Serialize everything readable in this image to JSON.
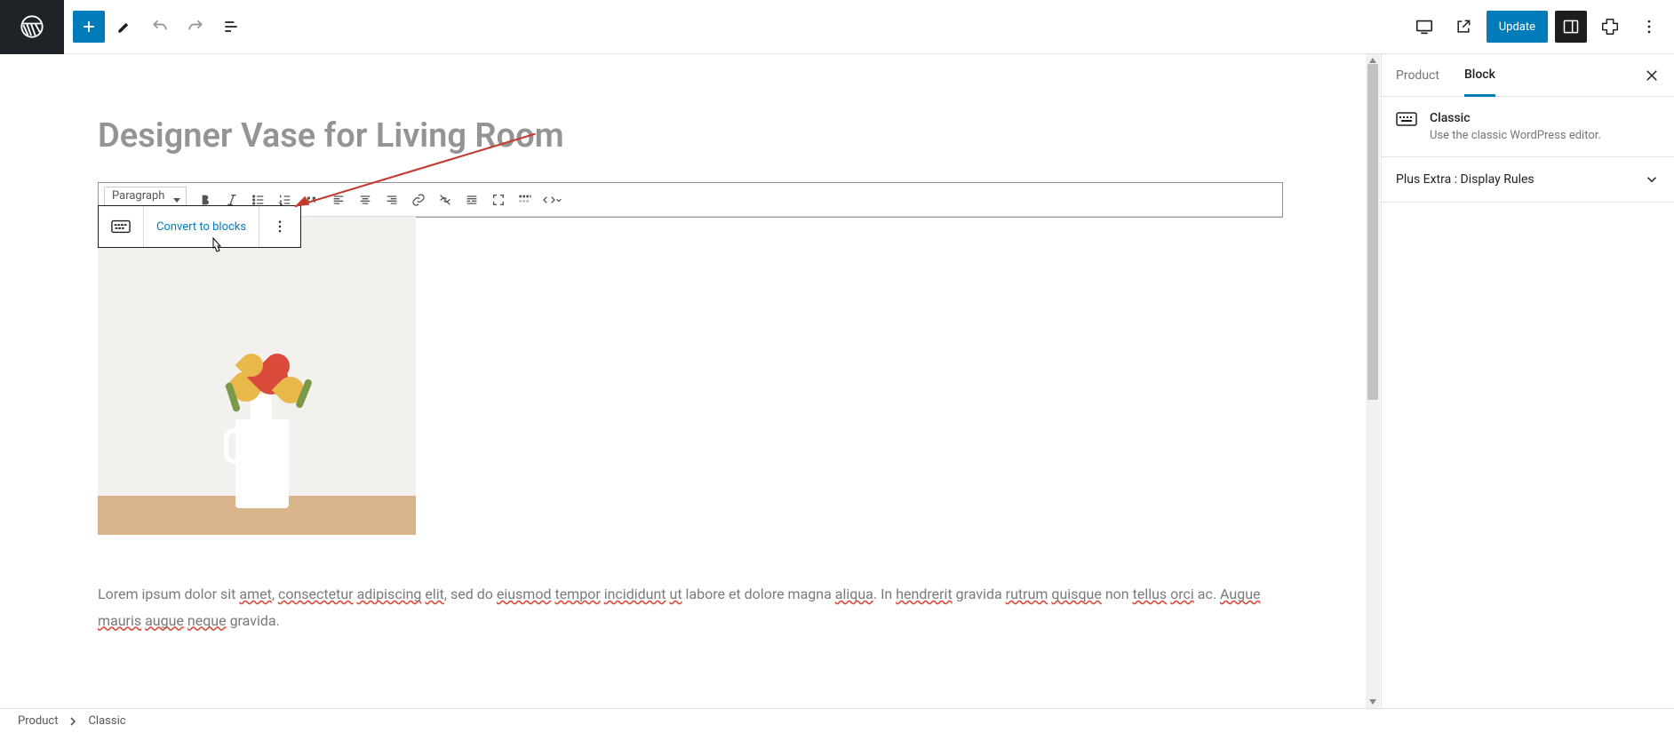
{
  "topbar": {
    "update_label": "Update"
  },
  "block_toolbar": {
    "convert_label": "Convert to blocks"
  },
  "post": {
    "title": "Designer Vase for Living Room"
  },
  "classic_editor": {
    "format_select": "Paragraph",
    "paragraph_pre": "Lorem ipsum dolor sit ",
    "w1": "amet",
    "s1": ", ",
    "w2": "consectetur",
    "s2": " ",
    "w3": "adipiscing",
    "s3": " ",
    "w4": "elit",
    "s4": ", sed do ",
    "w5": "eiusmod",
    "s5": " ",
    "w6": "tempor",
    "s6": " ",
    "w7": "incididunt",
    "s7": " ",
    "w8": "ut",
    "s8": " labore et dolore magna ",
    "w9": "aliqua",
    "s9": ". In ",
    "w10": "hendrerit",
    "s10": " gravida ",
    "w11": "rutrum",
    "s11": " ",
    "w12": "quisque",
    "s12": " non ",
    "w13": "tellus",
    "s13": " ",
    "w14": "orci",
    "s14": " ac. ",
    "w15": "Augue",
    "s15": " ",
    "w16": "mauris",
    "s16": " ",
    "w17": "augue",
    "s17": " ",
    "w18": "neque",
    "s18": " gravida."
  },
  "sidebar": {
    "tabs": {
      "product": "Product",
      "block": "Block"
    },
    "block_info": {
      "title": "Classic",
      "desc": "Use the classic WordPress editor."
    },
    "panel": {
      "display_rules": "Plus Extra : Display Rules"
    }
  },
  "breadcrumb": {
    "root": "Product",
    "current": "Classic"
  }
}
